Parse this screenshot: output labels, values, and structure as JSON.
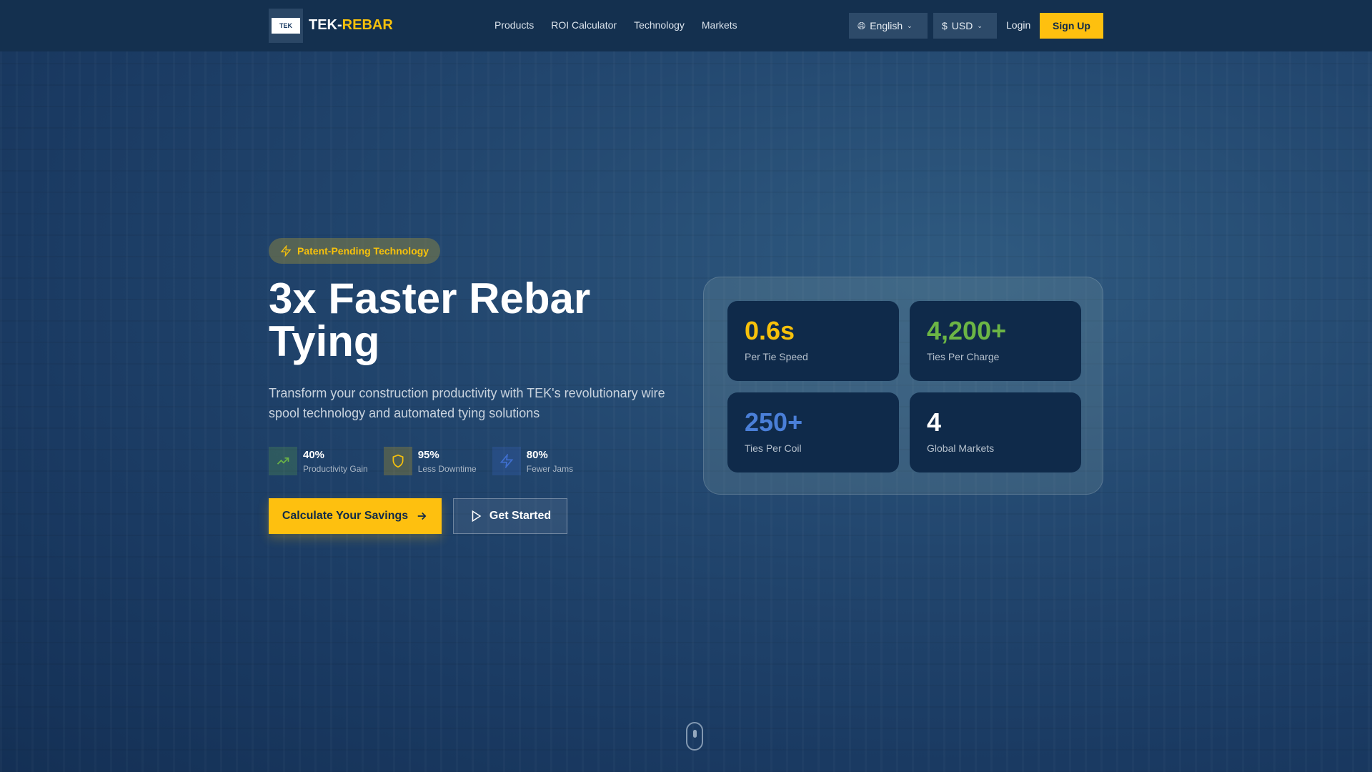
{
  "nav": {
    "logo_text": "TEK",
    "brand_part1": "TEK-",
    "brand_part2": "REBAR",
    "links": [
      "Products",
      "ROI Calculator",
      "Technology",
      "Markets"
    ],
    "language": "English",
    "currency": "USD",
    "login": "Login",
    "signup": "Sign Up"
  },
  "hero": {
    "badge": "Patent-Pending Technology",
    "title": "3x Faster Rebar Tying",
    "subtitle": "Transform your construction productivity with TEK's revolutionary wire spool technology and automated tying solutions",
    "features": [
      {
        "value": "40%",
        "label": "Productivity Gain",
        "icon": "trending-up-icon",
        "color": "#6cb545"
      },
      {
        "value": "95%",
        "label": "Less Downtime",
        "icon": "shield-icon",
        "color": "#f7c10b"
      },
      {
        "value": "80%",
        "label": "Fewer Jams",
        "icon": "lightning-icon",
        "color": "#3f6fd0"
      }
    ],
    "primary_button": "Calculate Your Savings",
    "secondary_button": "Get Started"
  },
  "stats": [
    {
      "value": "0.6s",
      "label": "Per Tie Speed",
      "color": "#f7c10b"
    },
    {
      "value": "4,200+",
      "label": "Ties Per Charge",
      "color": "#6cb545"
    },
    {
      "value": "250+",
      "label": "Ties Per Coil",
      "color": "#4a7fd8"
    },
    {
      "value": "4",
      "label": "Global Markets",
      "color": "#ffffff"
    }
  ]
}
